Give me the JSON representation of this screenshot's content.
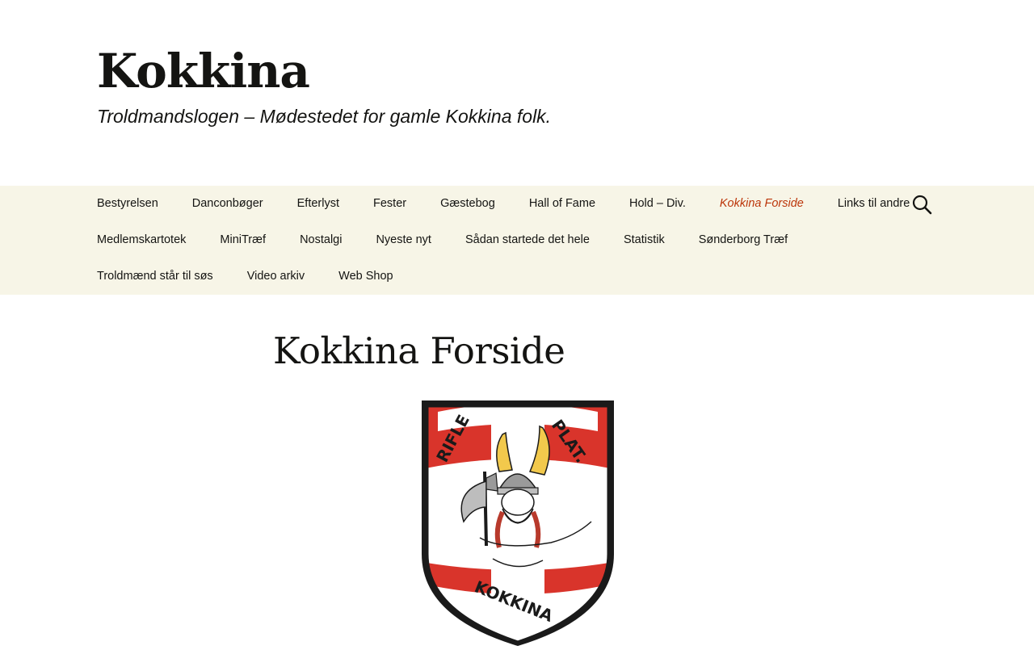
{
  "header": {
    "title": "Kokkina",
    "tagline": "Troldmandslogen – Mødestedet for gamle Kokkina folk."
  },
  "nav": {
    "rows": [
      [
        "Bestyrelsen",
        "Danconbøger",
        "Efterlyst",
        "Fester",
        "Gæstebog",
        "Hall of Fame",
        "Hold – Div.",
        "Kokkina Forside",
        "Links til andre"
      ],
      [
        "Medlemskartotek",
        "MiniTræf",
        "Nostalgi",
        "Nyeste nyt",
        "Sådan startede det hele",
        "Statistik",
        "Sønderborg Træf"
      ],
      [
        "Troldmænd står til søs",
        "Video arkiv",
        "Web Shop"
      ]
    ],
    "current": "Kokkina Forside",
    "search_icon": "search-icon"
  },
  "main": {
    "page_title": "Kokkina Forside",
    "logo": {
      "icon": "viking-shield-logo",
      "text_left": "RIFLE",
      "text_right": "PLAT.",
      "text_bottom": "KOKKINA"
    }
  },
  "colors": {
    "nav_background": "#f7f5e7",
    "current_link": "#bc360a",
    "text": "#141412",
    "shield_red": "#d9342b",
    "shield_border": "#1a1a1a"
  }
}
